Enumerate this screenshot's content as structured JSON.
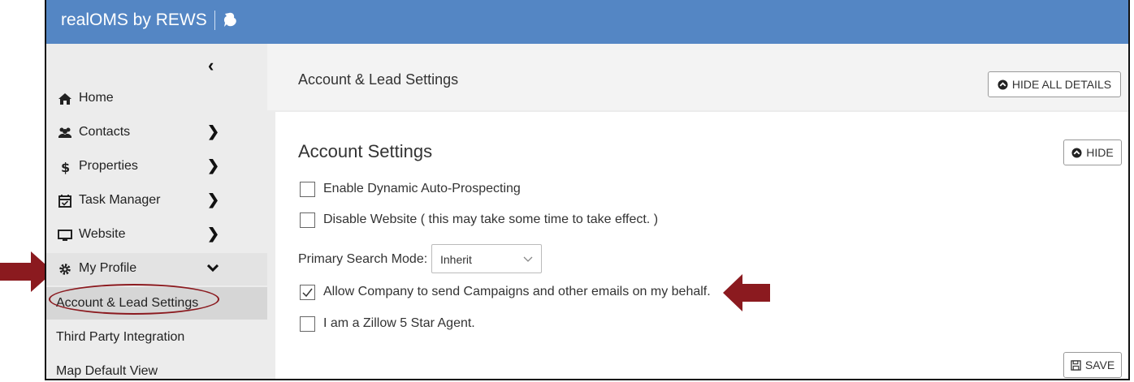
{
  "app": {
    "title": "realOMS by REWS"
  },
  "sidebar": {
    "collapse_glyph": "‹",
    "items": [
      {
        "label": "Home",
        "icon": "home-icon"
      },
      {
        "label": "Contacts",
        "icon": "users-icon"
      },
      {
        "label": "Properties",
        "icon": "dollar-icon"
      },
      {
        "label": "Task Manager",
        "icon": "calendar-check-icon"
      },
      {
        "label": "Website",
        "icon": "monitor-icon"
      },
      {
        "label": "My Profile",
        "icon": "gear-icon"
      }
    ],
    "sub_items": [
      {
        "label": "Account & Lead Settings"
      },
      {
        "label": "Third Party Integration"
      },
      {
        "label": "Map Default View"
      }
    ]
  },
  "header": {
    "title": "Account & Lead Settings",
    "hide_all_label": "HIDE ALL DETAILS"
  },
  "panel": {
    "title": "Account Settings",
    "hide_label": "HIDE",
    "checkboxes": [
      {
        "label": "Enable Dynamic Auto-Prospecting",
        "checked": false
      },
      {
        "label": "Disable Website ( this may take some time to take effect. )",
        "checked": false
      },
      {
        "label": "Allow Company to send Campaigns and other emails on my behalf.",
        "checked": true
      },
      {
        "label": "I am a Zillow 5 Star Agent.",
        "checked": false
      }
    ],
    "primary_search_mode": {
      "label": "Primary Search Mode:",
      "value": "Inherit"
    },
    "save_label": "SAVE"
  },
  "colors": {
    "topbar": "#5486c4",
    "annotation": "#8b1a1f"
  }
}
